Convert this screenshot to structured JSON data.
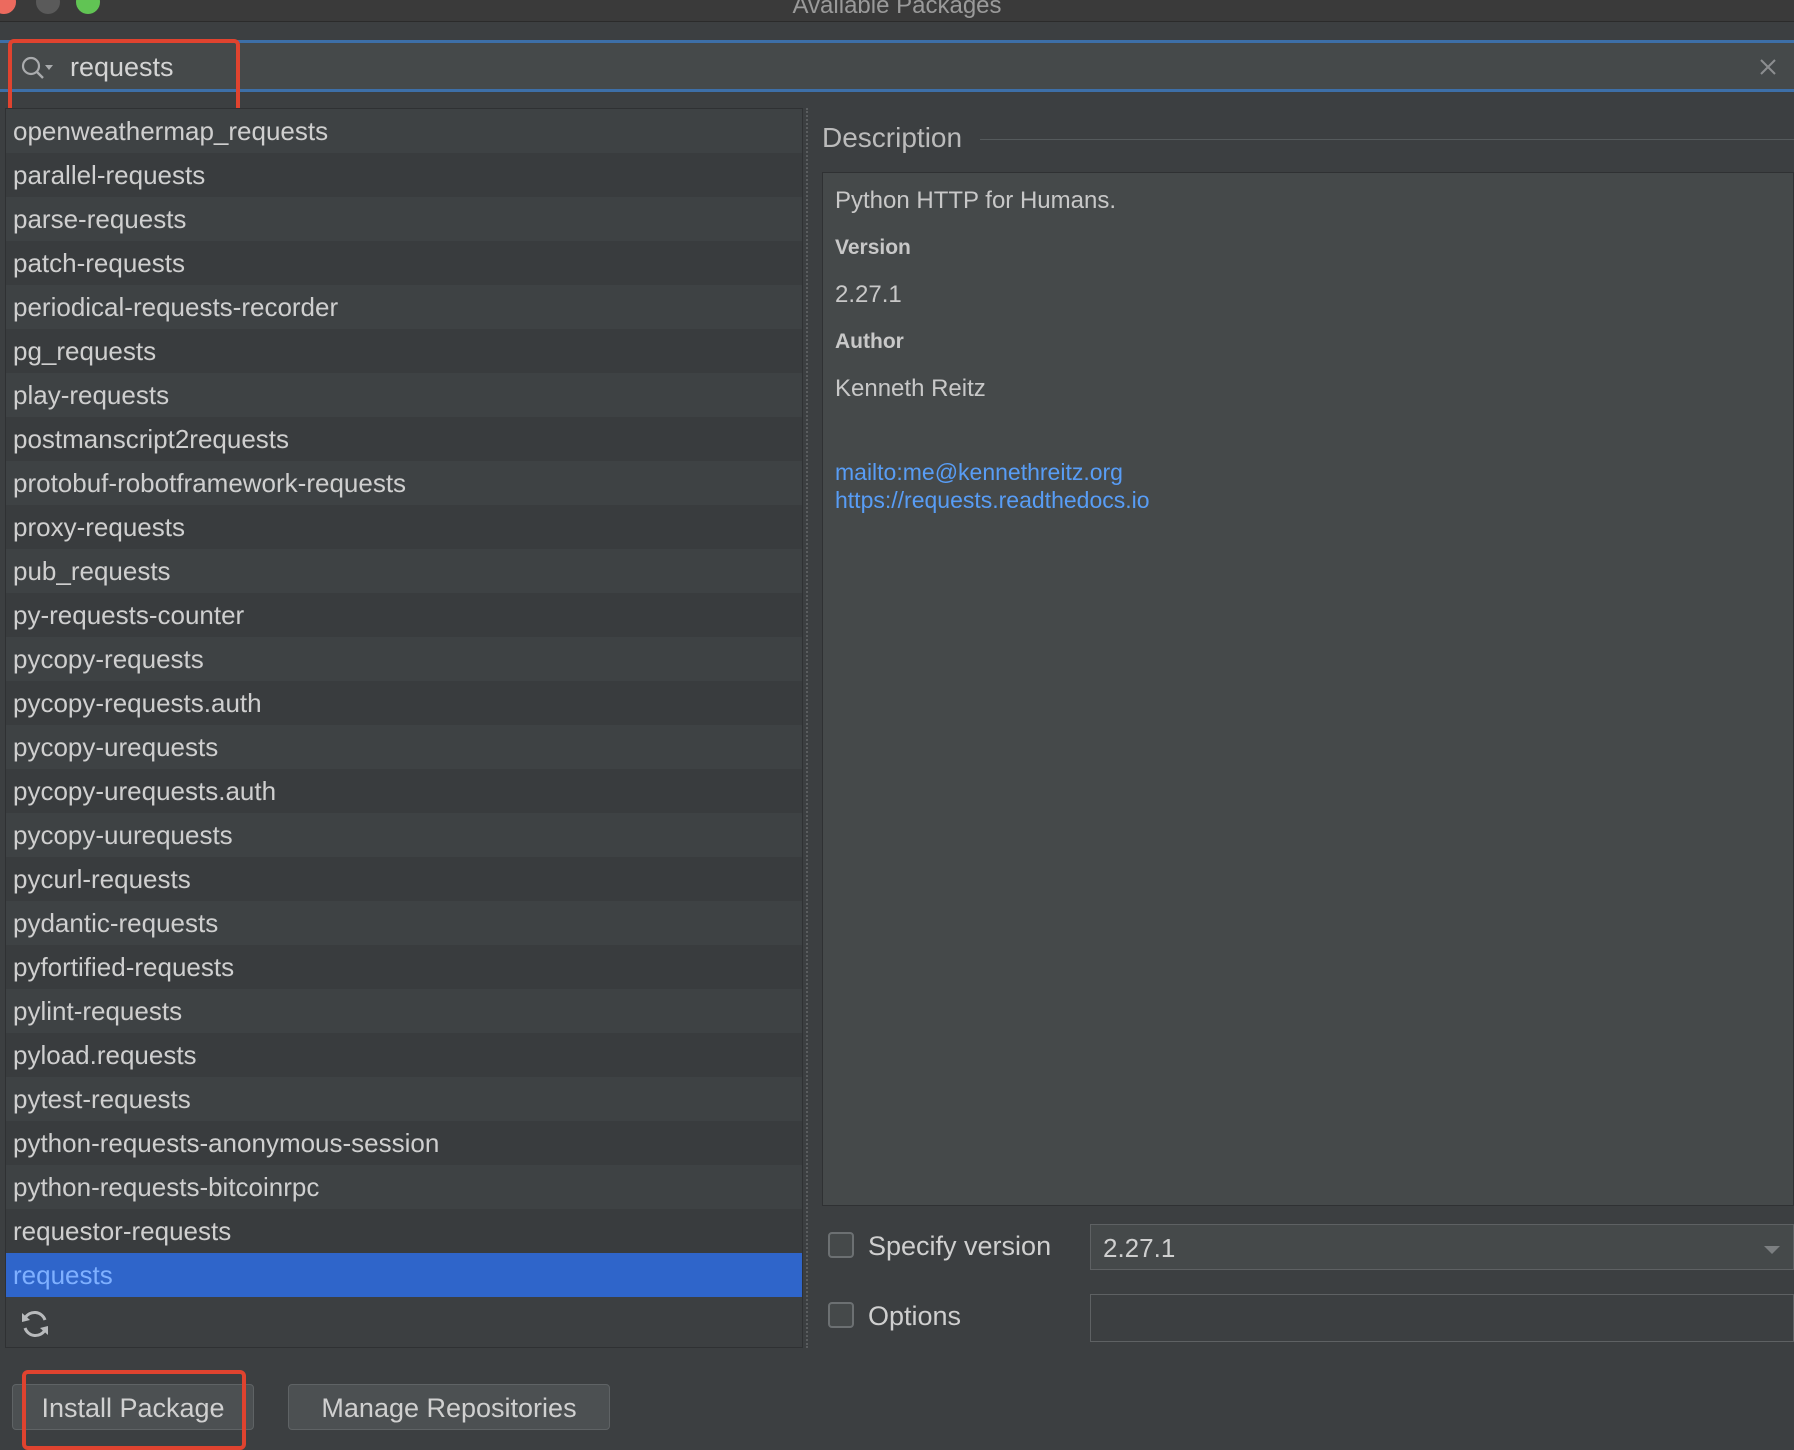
{
  "window": {
    "title": "Available Packages"
  },
  "search": {
    "value": "requests",
    "placeholder": ""
  },
  "packages": [
    "openweathermap_requests",
    "parallel-requests",
    "parse-requests",
    "patch-requests",
    "periodical-requests-recorder",
    "pg_requests",
    "play-requests",
    "postmanscript2requests",
    "protobuf-robotframework-requests",
    "proxy-requests",
    "pub_requests",
    "py-requests-counter",
    "pycopy-requests",
    "pycopy-requests.auth",
    "pycopy-urequests",
    "pycopy-urequests.auth",
    "pycopy-uurequests",
    "pycurl-requests",
    "pydantic-requests",
    "pyfortified-requests",
    "pylint-requests",
    "pyload.requests",
    "pytest-requests",
    "python-requests-anonymous-session",
    "python-requests-bitcoinrpc",
    "requestor-requests",
    "requests"
  ],
  "selected_package": "requests",
  "description": {
    "header": "Description",
    "summary": "Python HTTP for Humans.",
    "version_label": "Version",
    "version_value": "2.27.1",
    "author_label": "Author",
    "author_value": "Kenneth Reitz",
    "links": [
      "mailto:me@kennethreitz.org",
      "https://requests.readthedocs.io"
    ]
  },
  "options": {
    "specify_version_label": "Specify version",
    "specify_version_checked": false,
    "version_selected": "2.27.1",
    "options_label": "Options",
    "options_checked": false,
    "options_value": ""
  },
  "buttons": {
    "install": "Install Package",
    "manage": "Manage Repositories"
  },
  "icons": {
    "search": "search-icon",
    "clear": "close-icon",
    "refresh": "refresh-icon",
    "dropdown": "chevron-down-icon"
  },
  "colors": {
    "selection": "#2f65ca",
    "link": "#589df6",
    "annotation": "#e0432f"
  }
}
